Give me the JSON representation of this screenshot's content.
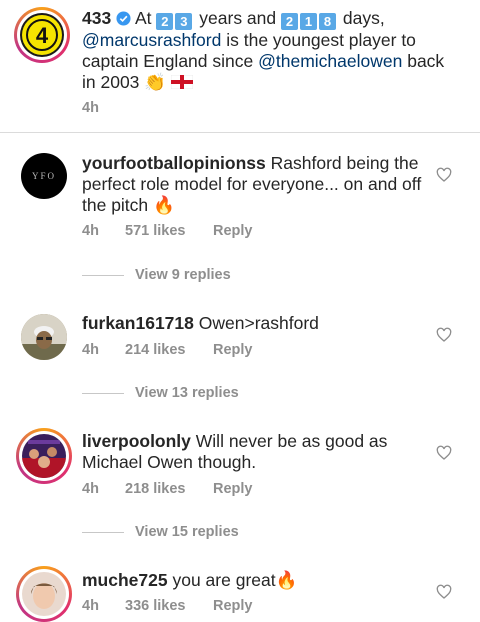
{
  "caption": {
    "username": "433",
    "text_prefix": "At",
    "years_digits": [
      "2",
      "3"
    ],
    "years_word": "years and",
    "days_digits": [
      "2",
      "1",
      "8"
    ],
    "days_word": "days,",
    "mention1": "@marcusrashford",
    "text_mid": "is the youngest player to captain England since",
    "mention2": "@themichaelowen",
    "text_end": "back in 2003",
    "emoji": "👏",
    "time": "4h"
  },
  "comments": [
    {
      "username": "yourfootballopinionss",
      "text": "Rashford being the perfect role model for everyone... on and off the pitch",
      "emoji": "🔥",
      "time": "4h",
      "likes": "571 likes",
      "reply": "Reply",
      "view_replies": "View 9 replies",
      "avatar_text": "YFO"
    },
    {
      "username": "furkan161718",
      "text": "Owen>rashford",
      "time": "4h",
      "likes": "214 likes",
      "reply": "Reply",
      "view_replies": "View 13 replies"
    },
    {
      "username": "liverpoolonly",
      "text": "Will never be as good as Michael Owen though.",
      "time": "4h",
      "likes": "218 likes",
      "reply": "Reply",
      "view_replies": "View 15 replies"
    },
    {
      "username": "muche725",
      "text": "you are great",
      "emoji": "🔥",
      "time": "4h",
      "likes": "336 likes",
      "reply": "Reply"
    }
  ],
  "colors": {
    "mention": "#00376b",
    "meta": "#8e8e8e",
    "ring_gradient": [
      "#f9a11b",
      "#e1306c",
      "#c13584"
    ],
    "logo_yellow": "#f5e400"
  }
}
